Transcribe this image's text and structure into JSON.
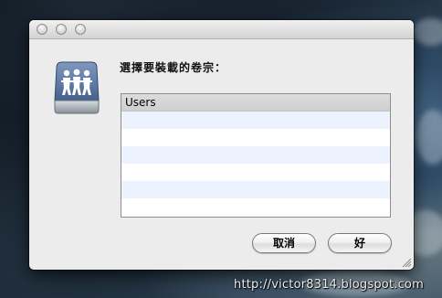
{
  "dialog": {
    "prompt": "選擇要裝載的卷宗：",
    "icon": "shared-volume-icon"
  },
  "volumes": {
    "items": [
      {
        "label": "Users",
        "selected": true
      }
    ]
  },
  "buttons": {
    "cancel_label": "取消",
    "ok_label": "好"
  },
  "watermark": "http://victor8314.blogspot.com"
}
